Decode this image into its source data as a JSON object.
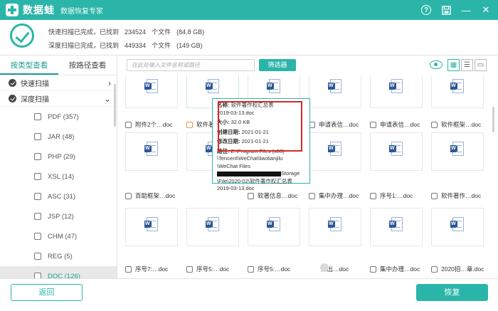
{
  "app": {
    "name": "数据蛙",
    "subtitle": "数据恢复专家"
  },
  "window": {
    "help_icon": "help-icon",
    "save_icon": "save-icon",
    "minimize": "—",
    "close": "✕"
  },
  "status": {
    "quick_line": [
      "快速扫描已完成，已找到",
      "234524",
      "个文件",
      "(84.8 GB)"
    ],
    "deep_line": [
      "深度扫描已完成，已找到",
      "449334",
      "个文件",
      "(149 GB)"
    ]
  },
  "sidebar": {
    "tabs": [
      "按类型查看",
      "按路径查看"
    ],
    "tree": [
      {
        "label": "快速扫描",
        "arrow": "›"
      },
      {
        "label": "深度扫描",
        "arrow": "⌄"
      }
    ],
    "categories": [
      "PDF (357)",
      "JAR (48)",
      "PHP (29)",
      "XSL (14)",
      "ASC (31)",
      "JSP (12)",
      "CHM (47)",
      "REG (5)",
      "DOC (126)"
    ]
  },
  "toolbar": {
    "search_placeholder": "在此处输入文件名称或路径",
    "filter_label": "筛选器",
    "view_grid": "▦",
    "view_list": "☰",
    "view_detail": "▭"
  },
  "files": [
    [
      "",
      "附件2个…doc",
      "软件著作…",
      "",
      "",
      "申请表信…doc",
      "申请表信…doc",
      "软件框架…doc"
    ],
    [
      "百助框架…doc",
      "",
      "",
      "软著信息…doc",
      "集中办理…doc",
      "序号1:…doc",
      "软件著作…doc"
    ],
    [
      "",
      "序号7:…doc",
      "序号5:…doc",
      "序号5:…doc",
      "",
      "进出…doc",
      "集中办理…doc",
      "2020招…章.doc"
    ]
  ],
  "tooltip": {
    "name_label": "名称:",
    "name_value": "软件著作权汇总表",
    "name_value2": "2019-03-13.doc",
    "size_label": "大小:",
    "size_value": "32.0 KB",
    "created_label": "创建日期:",
    "created_value": "2021-01-21",
    "modified_label": "修改日期:",
    "modified_value": "2021-01-21",
    "path_label": "路径:",
    "path_value": "E:\\Program Files (x86)",
    "path_l2": "\\Tencent\\WeChat\\liaotianjilu",
    "path_l3": "\\WeChat Files",
    "path_l4_suffix": "Storage",
    "path_l5": "\\File\\2020-02\\软件著作权汇总表",
    "path_l6": "2019-03-13.doc"
  },
  "bottom": {
    "back_label": "返回",
    "recover_label": "恢复"
  },
  "colors": {
    "accent": "#2bb5a9",
    "highlight_red": "#d62a2a"
  }
}
